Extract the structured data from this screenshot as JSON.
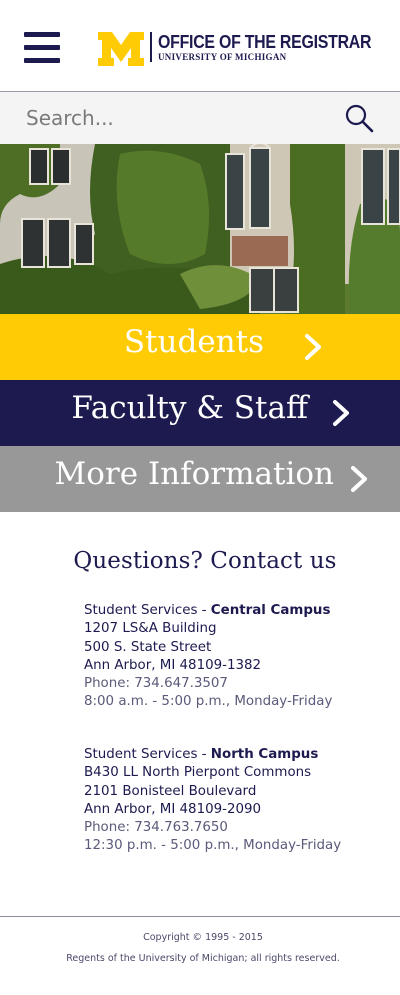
{
  "header": {
    "menu_icon": "hamburger-menu-icon",
    "logo_letter": "M",
    "title": "OFFICE OF THE REGISTRAR",
    "subtitle": "UNIVERSITY OF MICHIGAN",
    "brand_colors": {
      "maize": "#ffcb05",
      "blue": "#1c1a4f"
    }
  },
  "search": {
    "placeholder": "Search...",
    "icon": "search-icon"
  },
  "hero": {
    "description_icon": "ivy-building-photo"
  },
  "nav": [
    {
      "label": "Students",
      "color": "#ffcb05",
      "icon": "chevron-right-icon"
    },
    {
      "label": "Faculty & Staff",
      "color": "#1c1a4f",
      "icon": "chevron-right-icon"
    },
    {
      "label": "More Information",
      "color": "#989898",
      "icon": "chevron-right-icon"
    }
  ],
  "contact": {
    "title": "Questions? Contact us",
    "central": {
      "prefix": "Student Services - ",
      "campus": "Central Campus",
      "address1": "1207 LS&A Building",
      "address2": "500 S. State Street",
      "city": "Ann Arbor, MI 48109-1382",
      "phone": "Phone:  734.647.3507",
      "hours": "8:00 a.m. - 5:00 p.m., Monday-Friday"
    },
    "north": {
      "prefix": "Student Services - ",
      "campus": "North Campus",
      "address1": "B430 LL North Pierpont Commons",
      "address2": "2101 Bonisteel Boulevard",
      "city": "Ann Arbor, MI 48109-2090",
      "phone": "Phone:  734.763.7650",
      "hours": "12:30 p.m. - 5:00 p.m., Monday-Friday"
    }
  },
  "footer": {
    "copyright": "Copyright © 1995 - 2015",
    "rights": "Regents of the University of Michigan; all rights reserved."
  }
}
